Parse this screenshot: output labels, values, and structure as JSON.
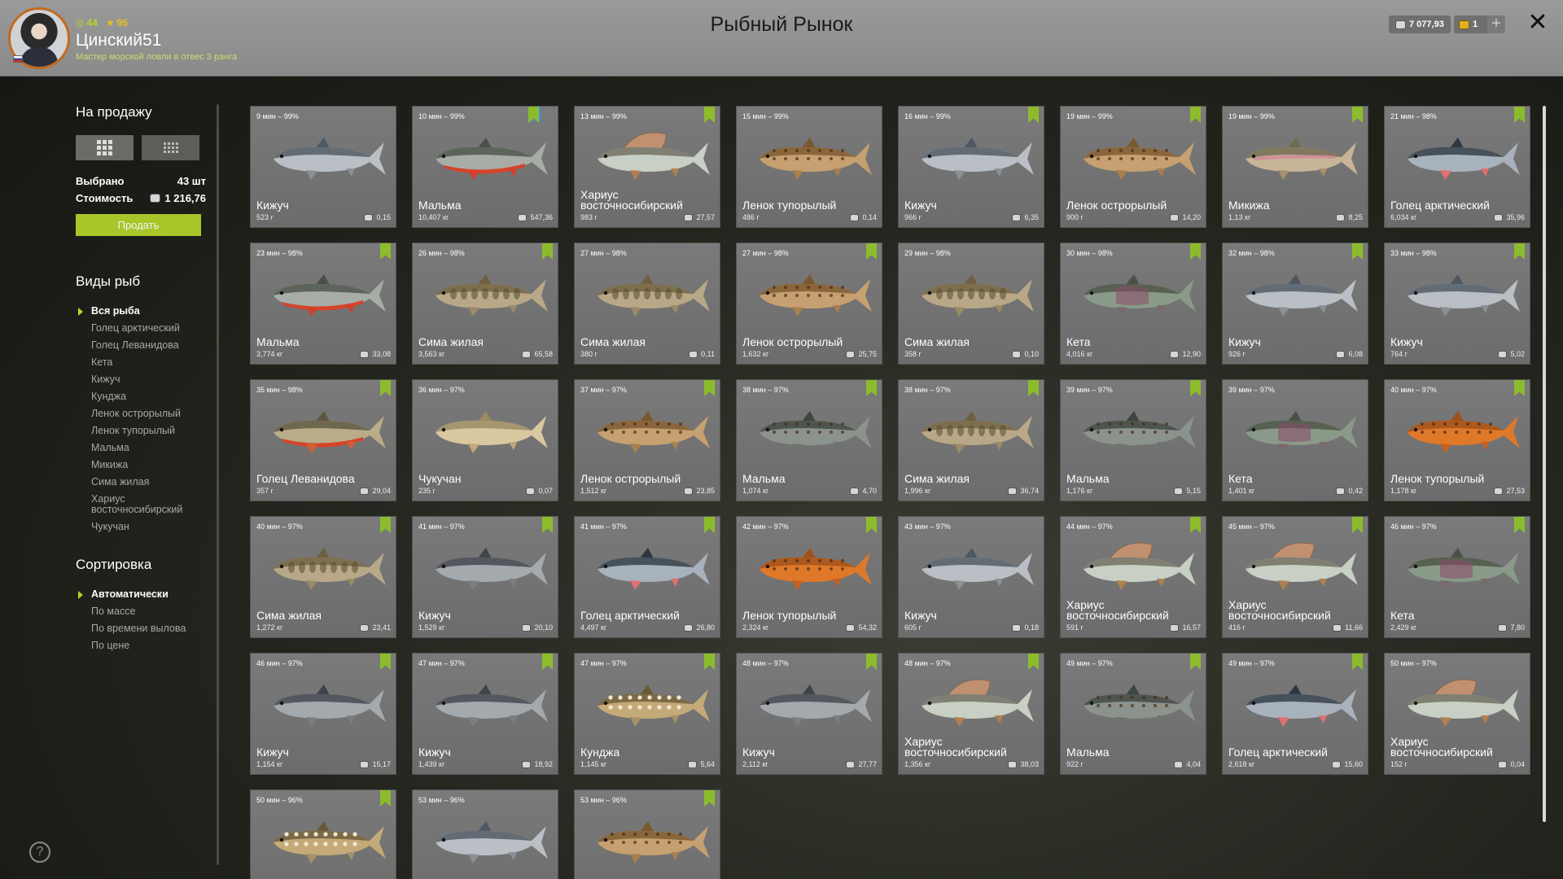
{
  "header": {
    "title": "Рыбный Рынок",
    "username": "Цинский51",
    "rank": "Мастер морской ловли в отвес 3 ранга",
    "stat1": "44",
    "stat2": "95",
    "money": "7 077,93",
    "gold": "1",
    "plus": "+",
    "close": "✕"
  },
  "sidebar": {
    "for_sale": "На продажу",
    "selected_label": "Выбрано",
    "selected_value": "43 шт",
    "cost_label": "Стоимость",
    "cost_value": "1 216,76",
    "sell_button": "Продать",
    "species_title": "Виды рыб",
    "species": [
      "Вся рыба",
      "Голец арктический",
      "Голец Леванидова",
      "Кета",
      "Кижуч",
      "Кунджа",
      "Ленок острорылый",
      "Ленок тупорылый",
      "Мальма",
      "Микижа",
      "Сима жилая",
      "Хариус восточносибирский",
      "Чукучан"
    ],
    "sort_title": "Сортировка",
    "sort_options": [
      "Автоматически",
      "По массе",
      "По времени вылова",
      "По цене"
    ]
  },
  "help": "?",
  "cards": [
    {
      "time": "9 мин – 99%",
      "name": "Кижуч",
      "weight": "523 г",
      "price": "0,15",
      "kind": "coho",
      "bm": ""
    },
    {
      "time": "10 мин – 99%",
      "name": "Мальма",
      "weight": "10,407 кг",
      "price": "547,36",
      "kind": "malma",
      "bm": "gb"
    },
    {
      "time": "13 мин – 99%",
      "name": "Хариус восточносибирский",
      "weight": "983 г",
      "price": "27,57",
      "kind": "grayling",
      "bm": "g"
    },
    {
      "time": "15 мин – 99%",
      "name": "Ленок тупорылый",
      "weight": "486 г",
      "price": "0,14",
      "kind": "lenok",
      "bm": ""
    },
    {
      "time": "16 мин – 99%",
      "name": "Кижуч",
      "weight": "966 г",
      "price": "6,35",
      "kind": "coho",
      "bm": "g"
    },
    {
      "time": "19 мин – 99%",
      "name": "Ленок острорылый",
      "weight": "900 г",
      "price": "14,20",
      "kind": "lenok",
      "bm": "g"
    },
    {
      "time": "19 мин – 99%",
      "name": "Микижа",
      "weight": "1,13 кг",
      "price": "8,25",
      "kind": "trout",
      "bm": "g"
    },
    {
      "time": "21 мин – 98%",
      "name": "Голец арктический",
      "weight": "6,034 кг",
      "price": "35,96",
      "kind": "char",
      "bm": "g"
    },
    {
      "time": "23 мин – 98%",
      "name": "Мальма",
      "weight": "3,774 кг",
      "price": "33,08",
      "kind": "malma",
      "bm": "g"
    },
    {
      "time": "26 мин – 98%",
      "name": "Сима жилая",
      "weight": "3,563 кг",
      "price": "65,58",
      "kind": "sima",
      "bm": "g"
    },
    {
      "time": "27 мин – 98%",
      "name": "Сима жилая",
      "weight": "380 г",
      "price": "0,11",
      "kind": "sima",
      "bm": ""
    },
    {
      "time": "27 мин – 98%",
      "name": "Ленок острорылый",
      "weight": "1,632 кг",
      "price": "25,75",
      "kind": "lenok",
      "bm": "g"
    },
    {
      "time": "29 мин – 98%",
      "name": "Сима жилая",
      "weight": "358 г",
      "price": "0,10",
      "kind": "sima",
      "bm": ""
    },
    {
      "time": "30 мин – 98%",
      "name": "Кета",
      "weight": "4,016 кг",
      "price": "12,90",
      "kind": "keta",
      "bm": "g"
    },
    {
      "time": "32 мин – 98%",
      "name": "Кижуч",
      "weight": "926 г",
      "price": "6,08",
      "kind": "coho",
      "bm": "g"
    },
    {
      "time": "33 мин – 98%",
      "name": "Кижуч",
      "weight": "764 г",
      "price": "5,02",
      "kind": "coho",
      "bm": "g"
    },
    {
      "time": "35 мин – 98%",
      "name": "Голец Леванидова",
      "weight": "357 г",
      "price": "29,04",
      "kind": "levan",
      "bm": "g"
    },
    {
      "time": "36 мин – 97%",
      "name": "Чукучан",
      "weight": "235 г",
      "price": "0,07",
      "kind": "sucker",
      "bm": ""
    },
    {
      "time": "37 мин – 97%",
      "name": "Ленок острорылый",
      "weight": "1,512 кг",
      "price": "23,85",
      "kind": "lenok",
      "bm": "g"
    },
    {
      "time": "38 мин – 97%",
      "name": "Мальма",
      "weight": "1,074 кг",
      "price": "4,70",
      "kind": "malmagray",
      "bm": "g"
    },
    {
      "time": "38 мин – 97%",
      "name": "Сима жилая",
      "weight": "1,996 кг",
      "price": "36,74",
      "kind": "sima",
      "bm": "g"
    },
    {
      "time": "39 мин – 97%",
      "name": "Мальма",
      "weight": "1,176 кг",
      "price": "5,15",
      "kind": "malmagray",
      "bm": "g"
    },
    {
      "time": "39 мин – 97%",
      "name": "Кета",
      "weight": "1,401 кг",
      "price": "0,42",
      "kind": "keta",
      "bm": ""
    },
    {
      "time": "40 мин – 97%",
      "name": "Ленок тупорылый",
      "weight": "1,178 кг",
      "price": "27,53",
      "kind": "lenokred",
      "bm": "g"
    },
    {
      "time": "40 мин – 97%",
      "name": "Сима жилая",
      "weight": "1,272 кг",
      "price": "23,41",
      "kind": "sima",
      "bm": "g"
    },
    {
      "time": "41 мин – 97%",
      "name": "Кижуч",
      "weight": "1,529 кг",
      "price": "20,10",
      "kind": "cohogray",
      "bm": "g"
    },
    {
      "time": "41 мин – 97%",
      "name": "Голец арктический",
      "weight": "4,497 кг",
      "price": "26,80",
      "kind": "char",
      "bm": "g"
    },
    {
      "time": "42 мин – 97%",
      "name": "Ленок тупорылый",
      "weight": "2,324 кг",
      "price": "54,32",
      "kind": "lenokred",
      "bm": "g"
    },
    {
      "time": "43 мин – 97%",
      "name": "Кижуч",
      "weight": "605 г",
      "price": "0,18",
      "kind": "coho",
      "bm": ""
    },
    {
      "time": "44 мин – 97%",
      "name": "Хариус восточносибирский",
      "weight": "591 г",
      "price": "16,57",
      "kind": "grayling",
      "bm": "g"
    },
    {
      "time": "45 мин – 97%",
      "name": "Хариус восточносибирский",
      "weight": "416 г",
      "price": "11,66",
      "kind": "grayling",
      "bm": "g"
    },
    {
      "time": "46 мин – 97%",
      "name": "Кета",
      "weight": "2,429 кг",
      "price": "7,80",
      "kind": "keta",
      "bm": "g"
    },
    {
      "time": "46 мин – 97%",
      "name": "Кижуч",
      "weight": "1,154 кг",
      "price": "15,17",
      "kind": "cohogray",
      "bm": "g"
    },
    {
      "time": "47 мин – 97%",
      "name": "Кижуч",
      "weight": "1,439 кг",
      "price": "18,92",
      "kind": "cohogray",
      "bm": "g"
    },
    {
      "time": "47 мин – 97%",
      "name": "Кунджа",
      "weight": "1,145 кг",
      "price": "5,64",
      "kind": "kundzha",
      "bm": "g"
    },
    {
      "time": "48 мин – 97%",
      "name": "Кижуч",
      "weight": "2,112 кг",
      "price": "27,77",
      "kind": "cohogray",
      "bm": "g"
    },
    {
      "time": "48 мин – 97%",
      "name": "Хариус восточносибирский",
      "weight": "1,356 кг",
      "price": "38,03",
      "kind": "grayling",
      "bm": "g"
    },
    {
      "time": "49 мин – 97%",
      "name": "Мальма",
      "weight": "922 г",
      "price": "4,04",
      "kind": "malmagray",
      "bm": "g"
    },
    {
      "time": "49 мин – 97%",
      "name": "Голец арктический",
      "weight": "2,618 кг",
      "price": "15,60",
      "kind": "char",
      "bm": "g"
    },
    {
      "time": "50 мин – 97%",
      "name": "Хариус восточносибирский",
      "weight": "152 г",
      "price": "0,04",
      "kind": "grayling",
      "bm": ""
    },
    {
      "time": "50 мин – 96%",
      "name": "",
      "weight": "",
      "price": "",
      "kind": "kundzha",
      "bm": "g"
    },
    {
      "time": "53 мин – 96%",
      "name": "",
      "weight": "",
      "price": "",
      "kind": "coho",
      "bm": ""
    },
    {
      "time": "53 мин – 96%",
      "name": "",
      "weight": "",
      "price": "",
      "kind": "lenok",
      "bm": "g"
    }
  ]
}
